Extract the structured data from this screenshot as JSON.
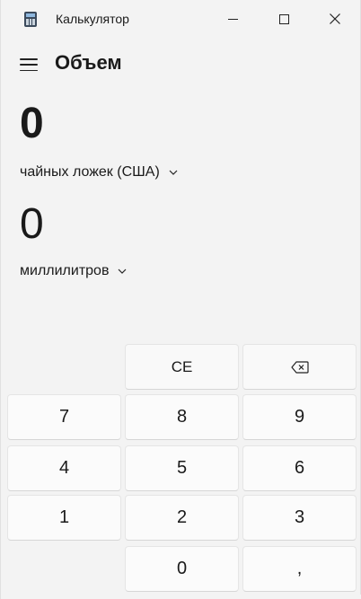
{
  "window": {
    "title": "Калькулятор",
    "icon": "calculator-icon"
  },
  "header": {
    "menu_icon": "hamburger-icon",
    "mode_title": "Объем"
  },
  "converter": {
    "from_value": "0",
    "from_unit": "чайных ложек (США)",
    "to_value": "0",
    "to_unit": "миллилитров"
  },
  "keypad": {
    "ce": "CE",
    "backspace_icon": "backspace-icon",
    "k7": "7",
    "k8": "8",
    "k9": "9",
    "k4": "4",
    "k5": "5",
    "k6": "6",
    "k1": "1",
    "k2": "2",
    "k3": "3",
    "k0": "0",
    "decimal": ","
  }
}
